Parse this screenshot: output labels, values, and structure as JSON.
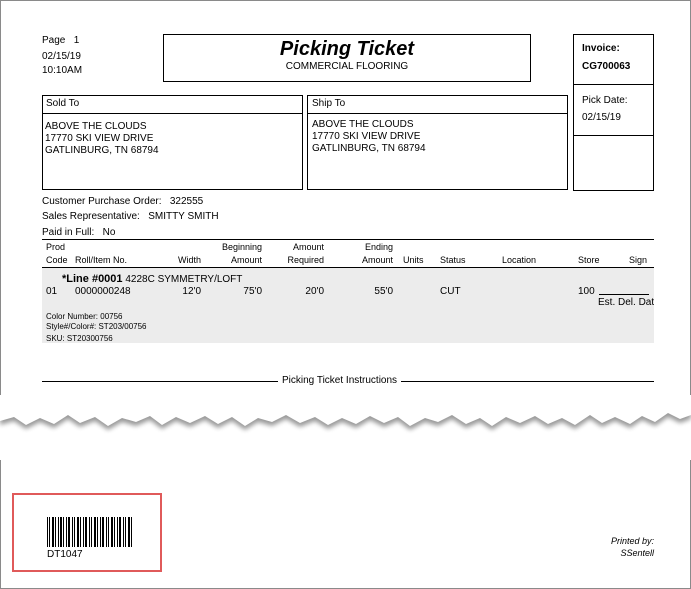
{
  "header": {
    "page_label": "Page",
    "page_number": "1",
    "date": "02/15/19",
    "time": "10:10AM",
    "title": "Picking Ticket",
    "subtitle": "COMMERCIAL FLOORING",
    "invoice_label": "Invoice:",
    "invoice_number": "CG700063",
    "pick_date_label": "Pick Date:",
    "pick_date": "02/15/19"
  },
  "sold_to": {
    "label": "Sold To",
    "lines": [
      "ABOVE THE CLOUDS",
      "17770 SKI VIEW DRIVE",
      "GATLINBURG, TN  68794"
    ]
  },
  "ship_to": {
    "label": "Ship To",
    "lines": [
      "ABOVE THE CLOUDS",
      "17770 SKI VIEW DRIVE",
      "GATLINBURG, TN  68794"
    ]
  },
  "order_info": {
    "po_label": "Customer Purchase Order:",
    "po_value": "322555",
    "rep_label": "Sales Representative:",
    "rep_value": "SMITTY SMITH",
    "paid_label": "Paid in Full:",
    "paid_value": "No"
  },
  "columns": {
    "prod_code": [
      "Prod",
      "Code"
    ],
    "roll_item": "Roll/Item No.",
    "width": "Width",
    "beginning_amount": [
      "Beginning",
      "Amount"
    ],
    "amount_required": [
      "Amount",
      "Required"
    ],
    "ending_amount": [
      "Ending",
      "Amount"
    ],
    "units": "Units",
    "status": "Status",
    "location": "Location",
    "store": "Store",
    "sign": "Sign"
  },
  "line_item": {
    "line_label": "*Line #0001",
    "description": "4228C SYMMETRY/LOFT",
    "prod_code": "01",
    "roll_item_no": "0000000248",
    "width": "12'0",
    "beginning_amount": "75'0",
    "amount_required": "20'0",
    "ending_amount": "55'0",
    "status": "CUT",
    "store": "100",
    "est_del": "Est. Del. Dat",
    "color_number": "Color Number: 00756",
    "style_color": "Style#/Color#: ST203/00756",
    "sku": "SKU: ST20300756"
  },
  "instructions_label": "Picking Ticket Instructions",
  "footer": {
    "barcode_text": "DT1047",
    "printed_by_label": "Printed by:",
    "printed_by": "SSentell"
  }
}
